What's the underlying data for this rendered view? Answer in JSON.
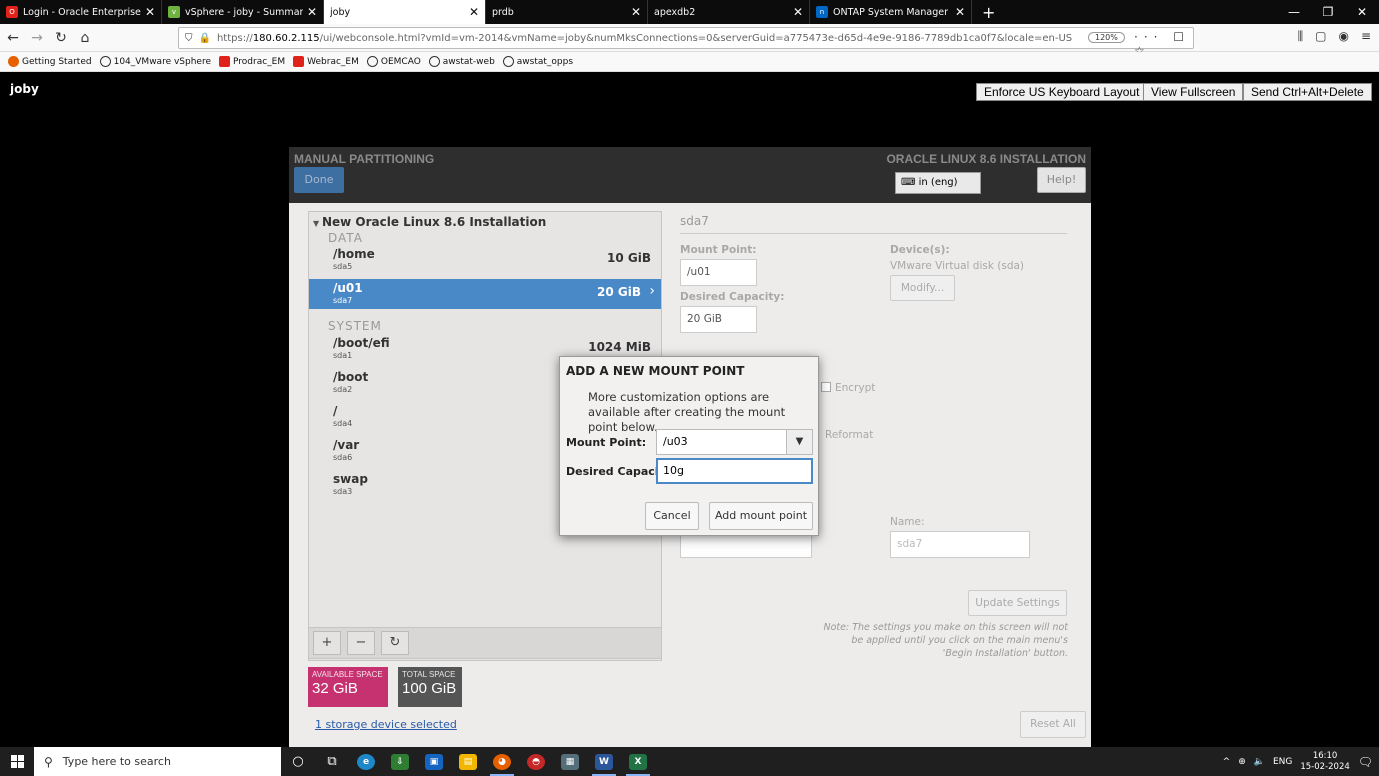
{
  "browser": {
    "tabs": [
      {
        "title": "Login - Oracle Enterprise Mana",
        "icon": "oracle-icon",
        "color": "#e0231a",
        "active": false
      },
      {
        "title": "vSphere - joby - Summary",
        "icon": "vsphere-icon",
        "color": "#6db33f",
        "active": false
      },
      {
        "title": "joby",
        "icon": "",
        "color": "",
        "active": true
      },
      {
        "title": "prdb",
        "icon": "",
        "color": "",
        "active": false
      },
      {
        "title": "apexdb2",
        "icon": "",
        "color": "",
        "active": false
      },
      {
        "title": "ONTAP System Manager",
        "icon": "netapp-icon",
        "color": "#0067c5",
        "active": false
      }
    ],
    "url_prefix": "https://",
    "url_host": "180.60.2.115",
    "url_rest": "/ui/webconsole.html?vmId=vm-2014&vmName=joby&numMksConnections=0&serverGuid=a775473e-d65d-4e9e-9186-7789db1ca0f7&locale=en-US",
    "zoom": "120%",
    "bookmarks": [
      "Getting Started",
      "104_VMware vSphere",
      "Prodrac_EM",
      "Webrac_EM",
      "OEMCAO",
      "awstat-web",
      "awstat_opps"
    ]
  },
  "vm": {
    "title": "joby",
    "btn_keyboard": "Enforce US Keyboard Layout",
    "btn_fullscreen": "View Fullscreen",
    "btn_cad": "Send Ctrl+Alt+Delete"
  },
  "installer": {
    "header_left": "MANUAL PARTITIONING",
    "header_right": "ORACLE LINUX 8.6 INSTALLATION",
    "done": "Done",
    "keyboard": "in (eng)",
    "help": "Help!",
    "install_title": "New Oracle Linux 8.6 Installation",
    "data_label": "DATA",
    "system_label": "SYSTEM",
    "data_mounts": [
      {
        "name": "/home",
        "dev": "sda5",
        "size": "10 GiB"
      },
      {
        "name": "/u01",
        "dev": "sda7",
        "size": "20 GiB"
      }
    ],
    "system_mounts": [
      {
        "name": "/boot/efi",
        "dev": "sda1",
        "size": "1024 MiB"
      },
      {
        "name": "/boot",
        "dev": "sda2",
        "size": ""
      },
      {
        "name": "/",
        "dev": "sda4",
        "size": ""
      },
      {
        "name": "/var",
        "dev": "sda6",
        "size": ""
      },
      {
        "name": "swap",
        "dev": "sda3",
        "size": ""
      }
    ],
    "available_label": "AVAILABLE SPACE",
    "available_value": "32 GiB",
    "total_label": "TOTAL SPACE",
    "total_value": "100 GiB",
    "storage_link": "1 storage device selected",
    "detail": {
      "heading": "sda7",
      "mount_label": "Mount Point:",
      "mount_value": "/u01",
      "capacity_label": "Desired Capacity:",
      "capacity_value": "20 GiB",
      "devices_label": "Device(s):",
      "devices_value": "VMware Virtual disk (sda)",
      "modify": "Modify...",
      "encrypt": "Encrypt",
      "reformat": "Reformat",
      "name_label": "Name:",
      "name_value": "sda7",
      "update": "Update Settings",
      "note": "Note:  The settings you make on this screen will not be applied until you click on the main menu's 'Begin Installation' button.",
      "reset": "Reset All"
    }
  },
  "dialog": {
    "title": "ADD A NEW MOUNT POINT",
    "desc": "More customization options are available after creating the mount point below.",
    "mount_label": "Mount Point:",
    "mount_value": "/u03",
    "capacity_label": "Desired Capacity:",
    "capacity_value": "10g",
    "cancel": "Cancel",
    "add": "Add mount point"
  },
  "taskbar": {
    "search_placeholder": "Type here to search",
    "lang": "ENG",
    "time": "16:10",
    "date": "15-02-2024"
  },
  "colors": {
    "selection": "#4a89c8",
    "available": "#c5326f",
    "total": "#555555"
  }
}
